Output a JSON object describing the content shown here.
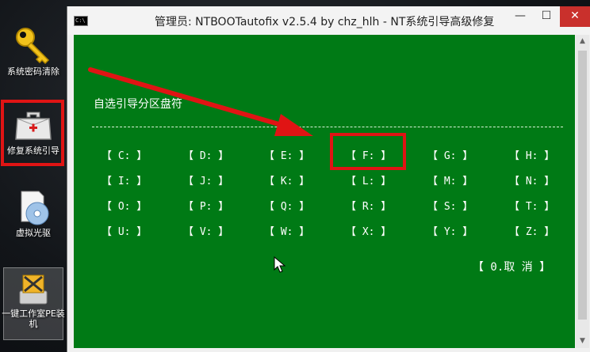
{
  "desktop": {
    "icons": [
      {
        "label": "系统密码清除",
        "icon": "key-icon"
      },
      {
        "label": "修复系统引导",
        "icon": "toolbox-icon"
      },
      {
        "label": "虚拟光驱",
        "icon": "disc-icon"
      },
      {
        "label": "一键工作室PE装机",
        "icon": "install-tool-icon"
      }
    ]
  },
  "window": {
    "title": "管理员: NTBOOTautofix v2.5.4 by chz_hlh - NT系统引导高级修复",
    "icon_text": "C:\\",
    "minimize": "—",
    "maximize": "☐",
    "close": "✕"
  },
  "console": {
    "heading": "自选引导分区盘符",
    "drives": [
      "【 C: 】",
      "【 D: 】",
      "【 E: 】",
      "【 F: 】",
      "【 G: 】",
      "【 H: 】",
      "【 I: 】",
      "【 J: 】",
      "【 K: 】",
      "【 L: 】",
      "【 M: 】",
      "【 N: 】",
      "【 O: 】",
      "【 P: 】",
      "【 Q: 】",
      "【 R: 】",
      "【 S: 】",
      "【 T: 】",
      "【 U: 】",
      "【 V: 】",
      "【 W: 】",
      "【 X: 】",
      "【 Y: 】",
      "【 Z: 】"
    ],
    "cancel": "【 0.取  消 】",
    "highlighted_drive": "【 F: 】"
  },
  "colors": {
    "console_bg": "#007a15",
    "highlight": "#e01414"
  }
}
